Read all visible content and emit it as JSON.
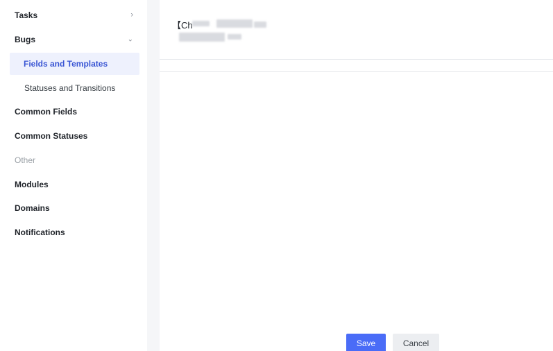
{
  "sidebar": {
    "items": [
      {
        "label": "Tasks",
        "chevron": "chevron-right-icon"
      },
      {
        "label": "Bugs",
        "chevron": "chevron-down-icon"
      },
      {
        "label": "Fields and Templates"
      },
      {
        "label": "Statuses and Transitions"
      },
      {
        "label": "Common Fields"
      },
      {
        "label": "Common Statuses"
      },
      {
        "label": "Other"
      },
      {
        "label": "Modules"
      },
      {
        "label": "Domains"
      },
      {
        "label": "Notifications"
      }
    ]
  },
  "main": {
    "template_text": "【Ch"
  },
  "actions": {
    "save_label": "Save",
    "cancel_label": "Cancel"
  },
  "colors": {
    "accent": "#4a6cf7",
    "active_bg": "#eef1fd",
    "active_text": "#3a56d4",
    "gutter": "#f5f6f8"
  }
}
